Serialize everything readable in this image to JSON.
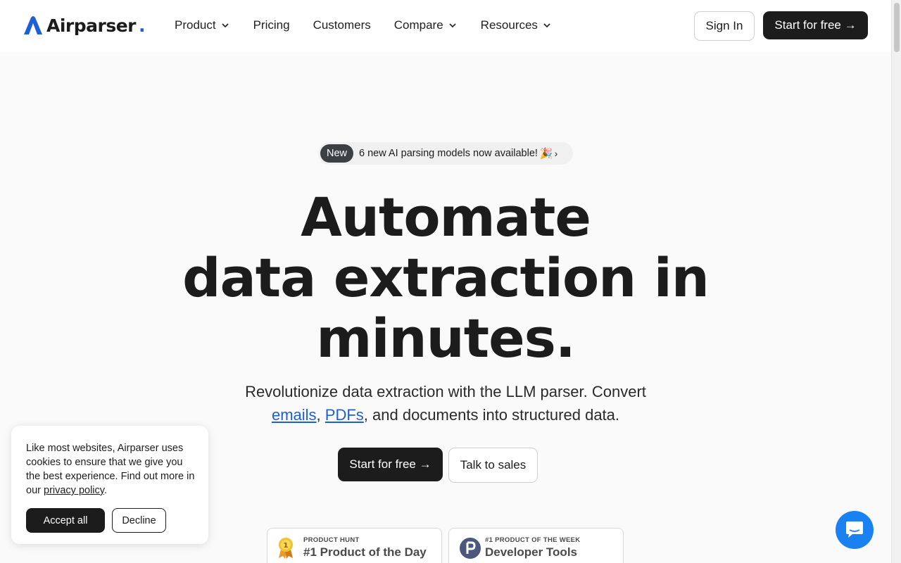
{
  "brand": {
    "name": "Airparser",
    "dot": ".",
    "accent": "#1f5fd6"
  },
  "nav": {
    "items": [
      {
        "label": "Product",
        "dropdown": true
      },
      {
        "label": "Pricing",
        "dropdown": false
      },
      {
        "label": "Customers",
        "dropdown": false
      },
      {
        "label": "Compare",
        "dropdown": true
      },
      {
        "label": "Resources",
        "dropdown": true
      }
    ],
    "sign_in": "Sign In",
    "start": "Start for free →"
  },
  "announcement": {
    "badge": "New",
    "text": "6 new AI parsing models now available!",
    "emoji": "🎉",
    "chevron": "›"
  },
  "hero": {
    "title_line1": "Automate",
    "title_line2": "data extraction in",
    "title_line3": "minutes.",
    "sub_before": "Revolutionize data extraction with the LLM parser. Convert",
    "link_emails": "emails",
    "comma": ",",
    "link_pdfs": "PDFs",
    "sub_after": ", and documents into structured data.",
    "cta_primary": "Start for free →",
    "cta_secondary": "Talk to sales"
  },
  "awards": [
    {
      "kicker": "PRODUCT HUNT",
      "title": "#1 Product of the Day",
      "icon": "medal-icon"
    },
    {
      "kicker": "#1 PRODUCT OF THE WEEK",
      "title": "Developer Tools",
      "icon": "product-hunt-icon"
    }
  ],
  "cookie": {
    "text": "Like most websites, Airparser uses cookies to ensure that we give you the best experience. Find out more in our",
    "link": "privacy policy",
    "period": ".",
    "accept": "Accept all",
    "decline": "Decline"
  },
  "chat": {
    "icon": "chat-icon",
    "color": "#1a82f0"
  }
}
